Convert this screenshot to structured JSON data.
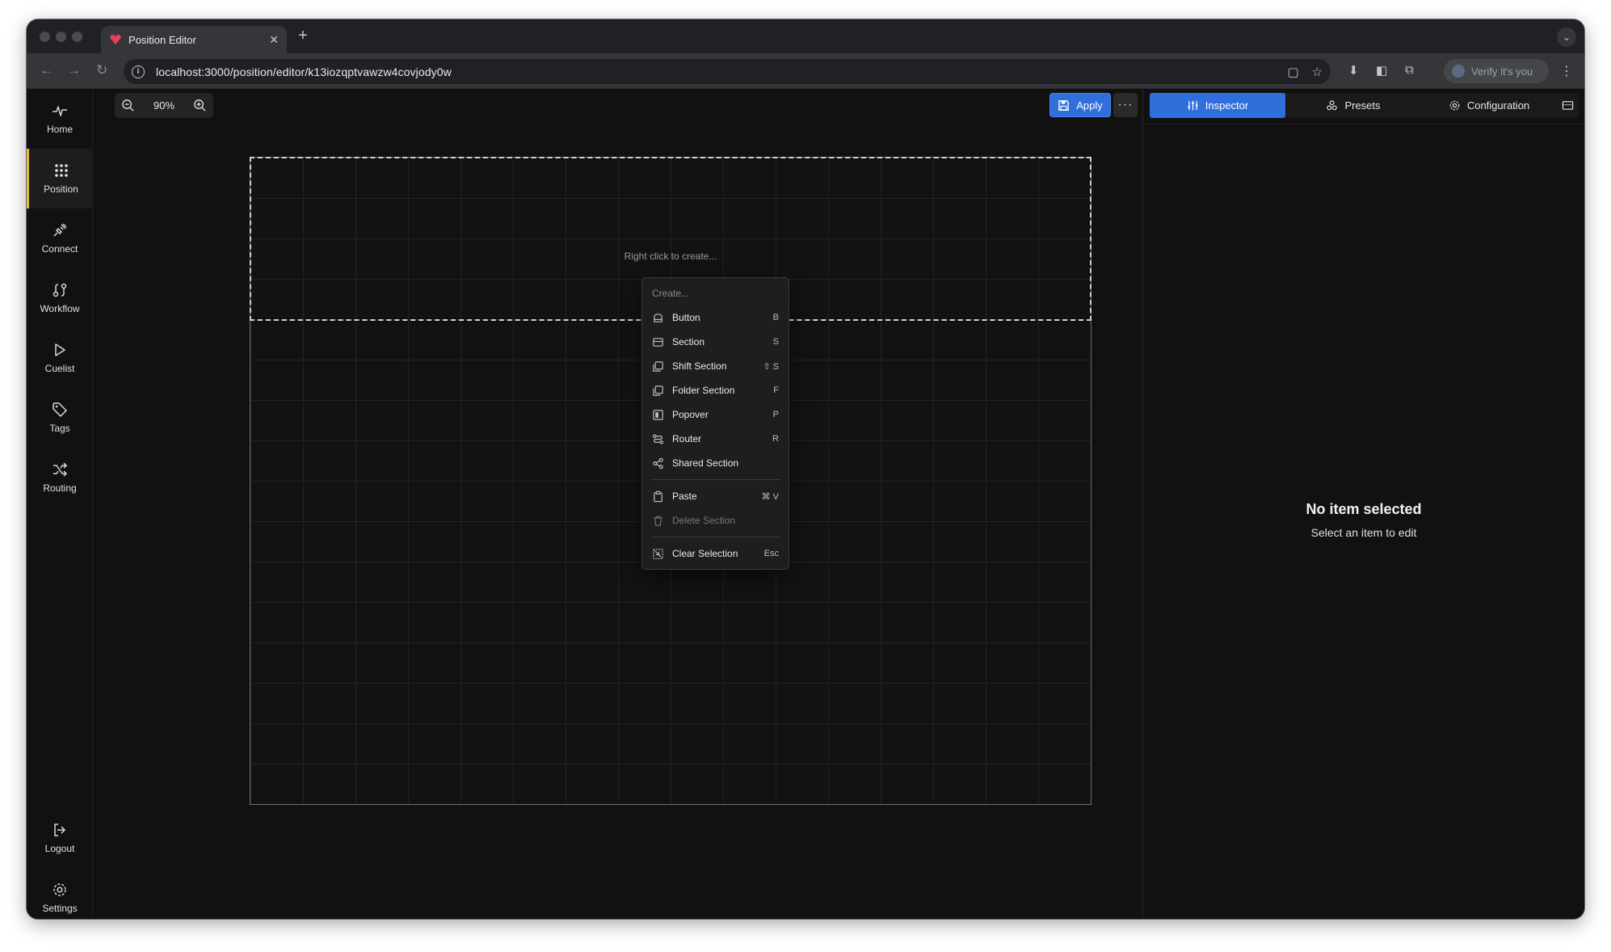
{
  "browser": {
    "tab_title": "Position Editor",
    "new_tab": "+",
    "url": "localhost:3000/position/editor/k13iozqptvawzw4covjody0w",
    "verify_label": "Verify it's you"
  },
  "sidebar": {
    "items": [
      {
        "label": "Home",
        "icon": "pulse-icon"
      },
      {
        "label": "Position",
        "icon": "grid-icon"
      },
      {
        "label": "Connect",
        "icon": "plug-icon"
      },
      {
        "label": "Workflow",
        "icon": "workflow-icon"
      },
      {
        "label": "Cuelist",
        "icon": "play-icon"
      },
      {
        "label": "Tags",
        "icon": "tag-icon"
      },
      {
        "label": "Routing",
        "icon": "shuffle-icon"
      }
    ],
    "bottom": [
      {
        "label": "Logout",
        "icon": "logout-icon"
      },
      {
        "label": "Settings",
        "icon": "gear-icon"
      }
    ],
    "active_color": "#e5b93b"
  },
  "toolbar": {
    "zoom": "90%",
    "apply_label": "Apply",
    "accent": "#2f6fdc"
  },
  "canvas": {
    "hint": "Right click to create..."
  },
  "context_menu": {
    "header": "Create...",
    "items": [
      {
        "label": "Button",
        "shortcut": "B"
      },
      {
        "label": "Section",
        "shortcut": "S"
      },
      {
        "label": "Shift Section",
        "shortcut": "⇧ S"
      },
      {
        "label": "Folder Section",
        "shortcut": "F"
      },
      {
        "label": "Popover",
        "shortcut": "P"
      },
      {
        "label": "Router",
        "shortcut": "R"
      },
      {
        "label": "Shared Section",
        "shortcut": ""
      }
    ],
    "actions": [
      {
        "label": "Paste",
        "shortcut": "⌘ V",
        "disabled": false
      },
      {
        "label": "Delete Section",
        "shortcut": "",
        "disabled": true
      }
    ],
    "clear": {
      "label": "Clear Selection",
      "shortcut": "Esc"
    }
  },
  "panel": {
    "tabs": [
      {
        "label": "Inspector",
        "active": true
      },
      {
        "label": "Presets",
        "active": false
      },
      {
        "label": "Configuration",
        "active": false
      }
    ],
    "empty_title": "No item selected",
    "empty_subtitle": "Select an item to edit"
  }
}
